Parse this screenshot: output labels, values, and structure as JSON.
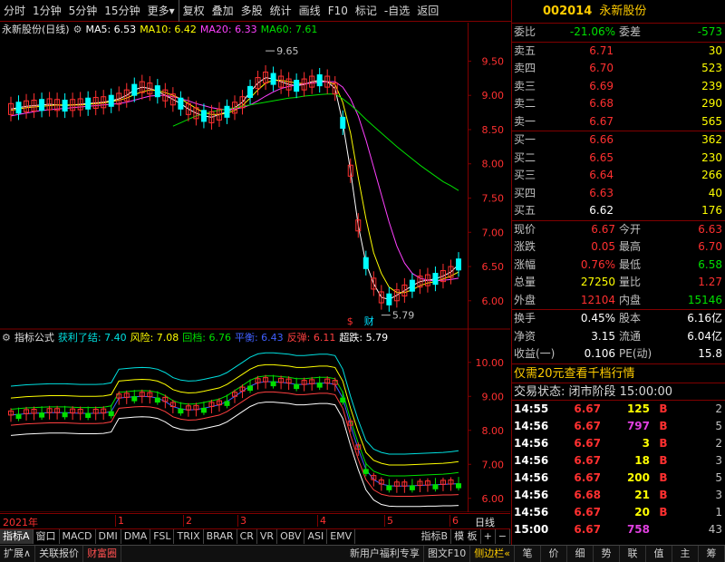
{
  "toolbar": {
    "items": [
      "分时",
      "1分钟",
      "5分钟",
      "15分钟",
      "更多",
      "复权",
      "叠加",
      "多股",
      "统计",
      "画线",
      "F10",
      "标记",
      "-自选",
      "返回"
    ]
  },
  "legend_main": {
    "stock": "永新股份(日线)",
    "ma5": "MA5: 6.53",
    "ma10": "MA10: 6.42",
    "ma20": "MA20: 6.33",
    "ma60": "MA60: 7.61",
    "colors": {
      "ma5": "#ffffff",
      "ma10": "#ffff00",
      "ma20": "#ff40ff",
      "ma60": "#00e000"
    }
  },
  "legend_sub": {
    "name": "指标公式",
    "v1": "获利了结: 7.40",
    "v2": "风险: 7.08",
    "v3": "回档: 6.76",
    "v4": "平衡: 6.43",
    "v5": "反弹: 6.11",
    "v6": "超跌: 5.79",
    "colors": {
      "v1": "#00e0e0",
      "v2": "#ffff00",
      "v3": "#00e000",
      "v4": "#4060ff",
      "v5": "#ff4040",
      "v6": "#ffffff"
    }
  },
  "annotations": {
    "high_label": "9.65",
    "low_label": "5.79",
    "mark_s": "$",
    "mark_cai": "财"
  },
  "time_axis": {
    "year": "2021年",
    "months": [
      "1",
      "2",
      "3",
      "4",
      "5",
      "6"
    ],
    "period": "日线"
  },
  "tabs_bottom1": [
    "指标A",
    "窗口",
    "MACD",
    "DMI",
    "DMA",
    "FSL",
    "TRIX",
    "BRAR",
    "CR",
    "VR",
    "OBV",
    "ASI",
    "EMV",
    "指标B",
    "模 板",
    "+",
    "−"
  ],
  "tabs_bottom2_left": [
    "扩展∧",
    "关联报价",
    "财富圈"
  ],
  "tabs_bottom2_mid": [
    "新用户福利专享",
    "图文F10",
    "侧边栏«"
  ],
  "tabs_bottom2_right": [
    "笔",
    "价",
    "细",
    "势",
    "联",
    "值",
    "主",
    "筹"
  ],
  "stock": {
    "code": "002014",
    "name": "永新股份"
  },
  "order_ratio": {
    "label1": "委比",
    "value1": "-21.06%",
    "label2": "委差",
    "value2": "-573"
  },
  "sell": [
    {
      "label": "卖五",
      "price": "6.71",
      "vol": "30"
    },
    {
      "label": "卖四",
      "price": "6.70",
      "vol": "523"
    },
    {
      "label": "卖三",
      "price": "6.69",
      "vol": "239"
    },
    {
      "label": "卖二",
      "price": "6.68",
      "vol": "290"
    },
    {
      "label": "卖一",
      "price": "6.67",
      "vol": "565"
    }
  ],
  "buy": [
    {
      "label": "买一",
      "price": "6.66",
      "vol": "362"
    },
    {
      "label": "买二",
      "price": "6.65",
      "vol": "230"
    },
    {
      "label": "买三",
      "price": "6.64",
      "vol": "266"
    },
    {
      "label": "买四",
      "price": "6.63",
      "vol": "40"
    },
    {
      "label": "买五",
      "price": "6.62",
      "vol": "176"
    }
  ],
  "stats1": [
    {
      "l1": "现价",
      "v1": "6.67",
      "l2": "今开",
      "v2": "6.63",
      "c1": "red",
      "c2": "red"
    },
    {
      "l1": "涨跌",
      "v1": "0.05",
      "l2": "最高",
      "v2": "6.70",
      "c1": "red",
      "c2": "red"
    },
    {
      "l1": "涨幅",
      "v1": "0.76%",
      "l2": "最低",
      "v2": "6.58",
      "c1": "red",
      "c2": "green"
    },
    {
      "l1": "总量",
      "v1": "27250",
      "l2": "量比",
      "v2": "1.27",
      "c1": "yellow",
      "c2": "red"
    },
    {
      "l1": "外盘",
      "v1": "12104",
      "l2": "内盘",
      "v2": "15146",
      "c1": "red",
      "c2": "green"
    }
  ],
  "stats2": [
    {
      "l1": "换手",
      "v1": "0.45%",
      "l2": "股本",
      "v2": "6.16亿"
    },
    {
      "l1": "净资",
      "v1": "3.15",
      "l2": "流通",
      "v2": "6.04亿"
    },
    {
      "l1": "收益(一)",
      "v1": "0.106",
      "l2": "PE(动)",
      "v2": "15.8"
    }
  ],
  "promo": "仅需20元查看千档行情",
  "trade_state": "交易状态: 闭市阶段 15:00:00",
  "ticks": [
    {
      "t": "14:55",
      "p": "6.67",
      "q": "125",
      "d": "B",
      "x": "2",
      "qc": "yellow"
    },
    {
      "t": "14:56",
      "p": "6.67",
      "q": "797",
      "d": "B",
      "x": "5",
      "qc": "magenta"
    },
    {
      "t": "14:56",
      "p": "6.67",
      "q": "3",
      "d": "B",
      "x": "2",
      "qc": "yellow"
    },
    {
      "t": "14:56",
      "p": "6.67",
      "q": "18",
      "d": "B",
      "x": "3",
      "qc": "yellow"
    },
    {
      "t": "14:56",
      "p": "6.67",
      "q": "200",
      "d": "B",
      "x": "5",
      "qc": "yellow"
    },
    {
      "t": "14:56",
      "p": "6.68",
      "q": "21",
      "d": "B",
      "x": "3",
      "qc": "yellow"
    },
    {
      "t": "14:56",
      "p": "6.67",
      "q": "20",
      "d": "B",
      "x": "1",
      "qc": "yellow"
    },
    {
      "t": "15:00",
      "p": "6.67",
      "q": "758",
      "d": "",
      "x": "43",
      "qc": "magenta"
    }
  ],
  "chart_data": [
    {
      "type": "line",
      "title": "永新股份(日线)",
      "ylabels": [
        "9.50",
        "9.00",
        "8.50",
        "8.00",
        "7.50",
        "7.00",
        "6.50",
        "6.00"
      ],
      "ylim": [
        5.6,
        9.85
      ],
      "series": [
        {
          "name": "MA5",
          "color": "#ffffff",
          "values": [
            8.8,
            8.82,
            8.84,
            8.85,
            8.86,
            8.87,
            8.86,
            8.85,
            8.86,
            8.87,
            8.88,
            8.89,
            8.9,
            8.92,
            8.95,
            9.0,
            9.08,
            9.12,
            9.1,
            9.06,
            9.0,
            8.94,
            8.88,
            8.8,
            8.74,
            8.7,
            8.68,
            8.72,
            8.76,
            8.82,
            8.9,
            9.05,
            9.18,
            9.26,
            9.24,
            9.2,
            9.16,
            9.14,
            9.16,
            9.2,
            9.22,
            9.2,
            9.1,
            8.6,
            7.9,
            7.1,
            6.55,
            6.25,
            6.05,
            6.02,
            6.08,
            6.15,
            6.22,
            6.28,
            6.3,
            6.32,
            6.36,
            6.42,
            6.53
          ]
        },
        {
          "name": "MA10",
          "color": "#ffff00",
          "values": [
            8.78,
            8.8,
            8.82,
            8.83,
            8.84,
            8.85,
            8.86,
            8.86,
            8.86,
            8.86,
            8.87,
            8.88,
            8.89,
            8.91,
            8.93,
            8.96,
            9.01,
            9.05,
            9.08,
            9.07,
            9.04,
            9.0,
            8.95,
            8.88,
            8.81,
            8.75,
            8.72,
            8.72,
            8.74,
            8.78,
            8.85,
            8.96,
            9.08,
            9.18,
            9.22,
            9.22,
            9.2,
            9.18,
            9.17,
            9.18,
            9.2,
            9.2,
            9.16,
            8.9,
            8.45,
            7.8,
            7.2,
            6.7,
            6.4,
            6.2,
            6.12,
            6.12,
            6.16,
            6.22,
            6.26,
            6.28,
            6.32,
            6.36,
            6.42
          ]
        },
        {
          "name": "MA20",
          "color": "#ff40ff",
          "values": [
            8.7,
            8.72,
            8.74,
            8.76,
            8.78,
            8.79,
            8.8,
            8.81,
            8.82,
            8.83,
            8.84,
            8.85,
            8.86,
            8.87,
            8.88,
            8.9,
            8.93,
            8.96,
            8.99,
            9.0,
            9.0,
            8.98,
            8.95,
            8.92,
            8.88,
            8.85,
            8.82,
            8.8,
            8.79,
            8.8,
            8.82,
            8.86,
            8.92,
            8.99,
            9.05,
            9.1,
            9.13,
            9.15,
            9.17,
            9.18,
            9.19,
            9.2,
            9.2,
            9.12,
            8.95,
            8.7,
            8.35,
            7.95,
            7.55,
            7.15,
            6.8,
            6.55,
            6.4,
            6.33,
            6.3,
            6.29,
            6.3,
            6.31,
            6.33
          ]
        },
        {
          "name": "MA60",
          "color": "#00e000",
          "values": [
            null,
            null,
            null,
            null,
            null,
            null,
            null,
            null,
            null,
            null,
            null,
            null,
            null,
            null,
            null,
            null,
            null,
            null,
            null,
            null,
            null,
            8.55,
            8.6,
            8.65,
            8.7,
            8.73,
            8.76,
            8.78,
            8.8,
            8.82,
            8.84,
            8.86,
            8.88,
            8.9,
            8.92,
            8.94,
            8.96,
            8.97,
            8.99,
            9.0,
            9.01,
            9.02,
            9.02,
            8.95,
            8.86,
            8.76,
            8.65,
            8.55,
            8.45,
            8.35,
            8.25,
            8.16,
            8.07,
            7.98,
            7.9,
            7.82,
            7.74,
            7.68,
            7.61
          ]
        }
      ]
    },
    {
      "type": "line",
      "title": "指标公式",
      "ylabels": [
        "10.00",
        "9.00",
        "8.00",
        "7.00",
        "6.00"
      ],
      "ylim": [
        5.7,
        10.5
      ],
      "series": [
        {
          "name": "获利了结",
          "color": "#00e0e0",
          "values": [
            9.3,
            9.32,
            9.34,
            9.35,
            9.36,
            9.37,
            9.37,
            9.37,
            9.36,
            9.35,
            9.35,
            9.35,
            9.36,
            9.4,
            9.8,
            9.82,
            9.84,
            9.85,
            9.84,
            9.8,
            9.7,
            9.55,
            9.48,
            9.45,
            9.46,
            9.5,
            9.55,
            9.6,
            9.7,
            9.85,
            10.0,
            10.15,
            10.25,
            10.28,
            10.28,
            10.26,
            10.24,
            10.2,
            10.2,
            10.22,
            10.24,
            10.24,
            10.2,
            9.8,
            9.0,
            8.3,
            7.7,
            7.45,
            7.35,
            7.3,
            7.3,
            7.3,
            7.31,
            7.32,
            7.33,
            7.34,
            7.35,
            7.37,
            7.4
          ]
        },
        {
          "name": "风险",
          "color": "#ffff00",
          "values": [
            8.95,
            8.97,
            8.99,
            9.0,
            9.01,
            9.02,
            9.02,
            9.02,
            9.01,
            9.0,
            9.0,
            9.0,
            9.01,
            9.05,
            9.45,
            9.47,
            9.49,
            9.5,
            9.49,
            9.45,
            9.35,
            9.2,
            9.13,
            9.1,
            9.11,
            9.15,
            9.2,
            9.25,
            9.35,
            9.5,
            9.65,
            9.8,
            9.9,
            9.93,
            9.93,
            9.91,
            9.89,
            9.85,
            9.85,
            9.87,
            9.89,
            9.89,
            9.85,
            9.45,
            8.65,
            7.95,
            7.35,
            7.12,
            7.03,
            6.98,
            6.98,
            6.98,
            6.99,
            7.0,
            7.01,
            7.02,
            7.03,
            7.05,
            7.08
          ]
        },
        {
          "name": "回档",
          "color": "#00e000",
          "values": [
            8.62,
            8.64,
            8.66,
            8.67,
            8.68,
            8.69,
            8.69,
            8.69,
            8.68,
            8.67,
            8.67,
            8.67,
            8.68,
            8.72,
            9.12,
            9.14,
            9.16,
            9.17,
            9.16,
            9.12,
            9.02,
            8.87,
            8.8,
            8.77,
            8.78,
            8.82,
            8.87,
            8.92,
            9.02,
            9.17,
            9.32,
            9.47,
            9.57,
            9.6,
            9.6,
            9.58,
            9.56,
            9.52,
            9.52,
            9.54,
            9.56,
            9.56,
            9.52,
            9.12,
            8.32,
            7.62,
            7.02,
            6.8,
            6.71,
            6.66,
            6.66,
            6.66,
            6.67,
            6.68,
            6.69,
            6.7,
            6.71,
            6.73,
            6.76
          ]
        },
        {
          "name": "平衡",
          "color": "#4060ff",
          "values": [
            8.45,
            8.47,
            8.49,
            8.5,
            8.51,
            8.52,
            8.52,
            8.52,
            8.51,
            8.5,
            8.5,
            8.5,
            8.51,
            8.55,
            8.95,
            8.97,
            8.99,
            9.0,
            8.99,
            8.95,
            8.85,
            8.7,
            8.63,
            8.6,
            8.61,
            8.65,
            8.7,
            8.75,
            8.85,
            9.0,
            9.15,
            9.3,
            9.4,
            9.43,
            9.43,
            9.41,
            9.39,
            9.35,
            9.35,
            9.37,
            9.39,
            9.39,
            9.35,
            8.95,
            8.15,
            7.45,
            6.85,
            6.55,
            6.42,
            6.37,
            6.36,
            6.36,
            6.37,
            6.38,
            6.39,
            6.4,
            6.41,
            6.42,
            6.43
          ]
        },
        {
          "name": "反弹",
          "color": "#ff4040",
          "values": [
            8.15,
            8.17,
            8.19,
            8.2,
            8.21,
            8.22,
            8.22,
            8.22,
            8.21,
            8.2,
            8.2,
            8.2,
            8.21,
            8.25,
            8.65,
            8.67,
            8.69,
            8.7,
            8.69,
            8.65,
            8.55,
            8.4,
            8.33,
            8.3,
            8.31,
            8.35,
            8.4,
            8.45,
            8.55,
            8.7,
            8.85,
            9.0,
            9.1,
            9.13,
            9.13,
            9.11,
            9.09,
            9.05,
            9.05,
            9.07,
            9.09,
            9.09,
            9.05,
            8.65,
            7.85,
            7.15,
            6.55,
            6.25,
            6.12,
            6.07,
            6.06,
            6.06,
            6.06,
            6.07,
            6.08,
            6.09,
            6.1,
            6.1,
            6.11
          ]
        },
        {
          "name": "超跌",
          "color": "#ffffff",
          "values": [
            7.85,
            7.87,
            7.89,
            7.9,
            7.91,
            7.92,
            7.92,
            7.92,
            7.91,
            7.9,
            7.9,
            7.9,
            7.91,
            7.95,
            8.35,
            8.37,
            8.39,
            8.4,
            8.39,
            8.35,
            8.25,
            8.1,
            8.03,
            8.0,
            8.01,
            8.05,
            8.1,
            8.15,
            8.25,
            8.4,
            8.55,
            8.7,
            8.8,
            8.83,
            8.83,
            8.81,
            8.79,
            8.75,
            8.75,
            8.77,
            8.79,
            8.79,
            8.75,
            8.35,
            7.55,
            6.85,
            6.25,
            5.95,
            5.82,
            5.77,
            5.76,
            5.76,
            5.76,
            5.76,
            5.77,
            5.77,
            5.78,
            5.78,
            5.79
          ]
        }
      ]
    }
  ]
}
